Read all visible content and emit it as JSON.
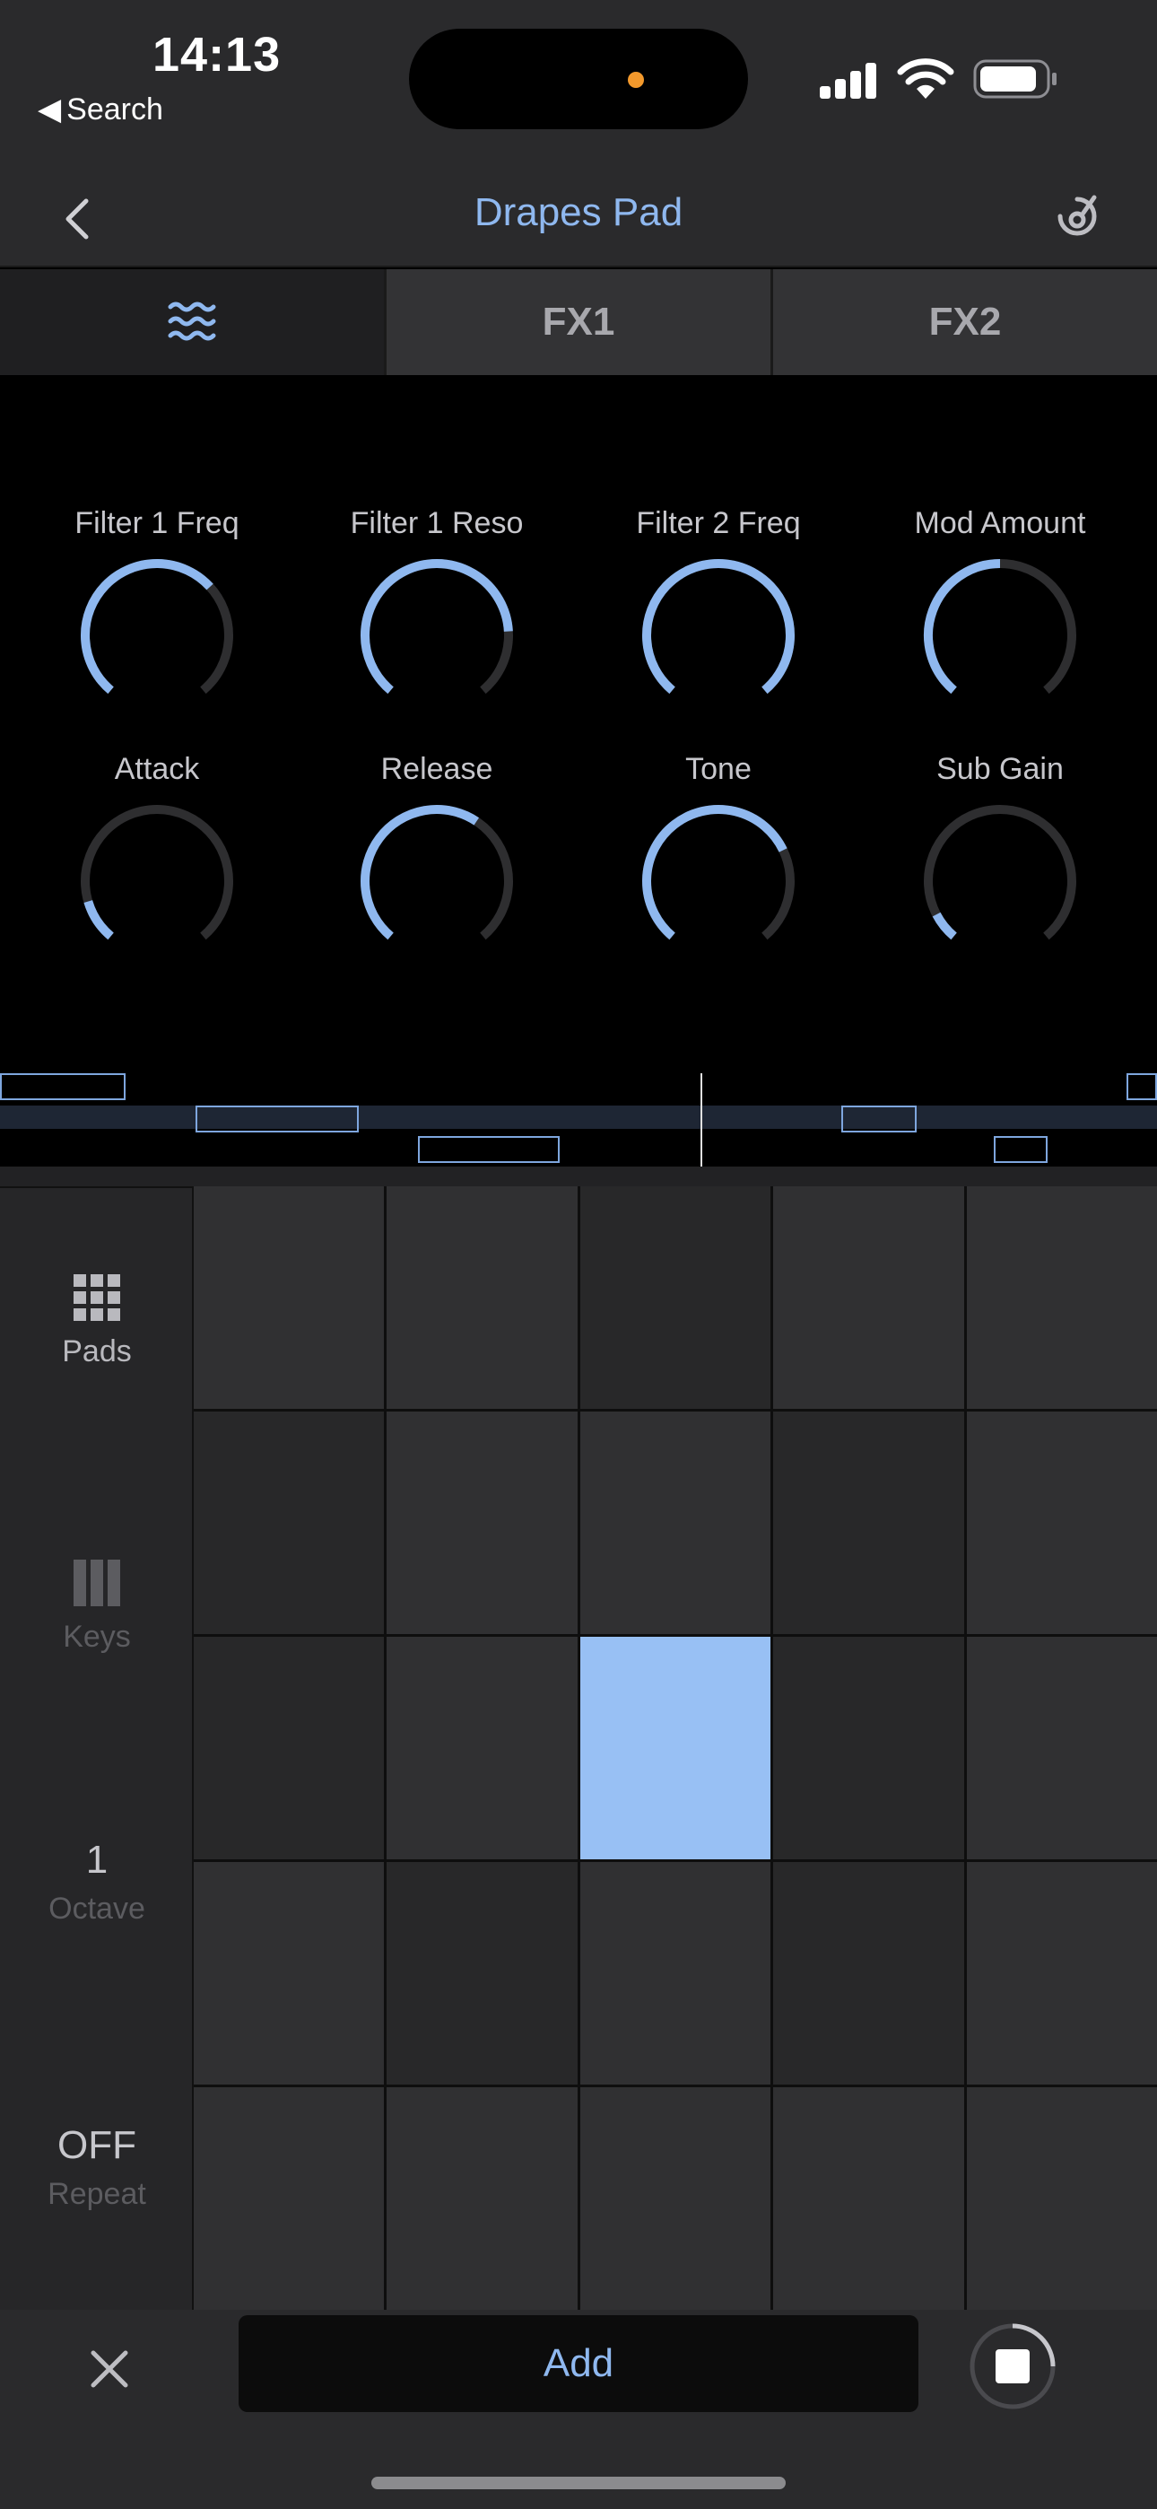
{
  "status": {
    "time": "14:13",
    "back_label": "Search"
  },
  "nav": {
    "title": "Drapes Pad"
  },
  "tabs": [
    {
      "label": "",
      "icon": "waves-icon",
      "active": true
    },
    {
      "label": "FX1",
      "active": false
    },
    {
      "label": "FX2",
      "active": false
    }
  ],
  "knobs": [
    {
      "label": "Filter 1 Freq",
      "value": 0.67
    },
    {
      "label": "Filter 1 Reso",
      "value": 0.81
    },
    {
      "label": "Filter 2 Freq",
      "value": 1.0
    },
    {
      "label": "Mod Amount",
      "value": 0.5
    },
    {
      "label": "Attack",
      "value": 0.12
    },
    {
      "label": "Release",
      "value": 0.62
    },
    {
      "label": "Tone",
      "value": 0.73
    },
    {
      "label": "Sub Gain",
      "value": 0.08
    }
  ],
  "sidebar": {
    "pads_label": "Pads",
    "keys_label": "Keys",
    "octave_value": "1",
    "octave_label": "Octave",
    "repeat_value": "OFF",
    "repeat_label": "Repeat"
  },
  "pads": {
    "active_row": 2,
    "active_col": 2
  },
  "bottom": {
    "add_label": "Add"
  },
  "colors": {
    "accent": "#8fb8ef",
    "pad_active": "#98c0f4",
    "knob_track": "#2e2e30"
  }
}
